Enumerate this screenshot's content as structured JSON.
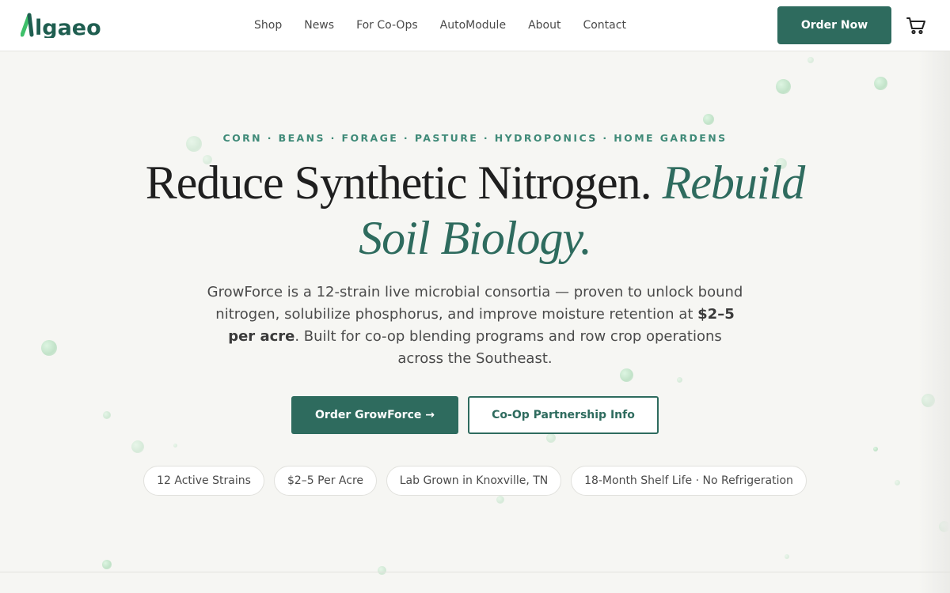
{
  "brand": {
    "logo_text": "lgaeo",
    "logo_color": "#1f5e50",
    "logo_accent": "#3ec06a"
  },
  "nav": {
    "items": [
      {
        "label": "Shop"
      },
      {
        "label": "News"
      },
      {
        "label": "For Co-Ops"
      },
      {
        "label": "AutoModule"
      },
      {
        "label": "About"
      },
      {
        "label": "Contact"
      }
    ],
    "order_label": "Order Now",
    "cart_icon": "cart-icon"
  },
  "hero": {
    "eyebrow": "CORN · BEANS · FORAGE · PASTURE · HYDROPONICS · HOME GARDENS",
    "headline_plain": "Reduce Synthetic Nitrogen.",
    "headline_accent": "Rebuild Soil Biology.",
    "lede_before": "GrowForce is a 12-strain live microbial consortia — proven to unlock bound nitrogen, solubilize phosphorus, and improve moisture retention at ",
    "lede_bold": "$2–5 per acre",
    "lede_after": ". Built for co-op blending programs and row crop operations across the Southeast.",
    "cta_primary": "Order GrowForce →",
    "cta_secondary": "Co-Op Partnership Info",
    "pills": [
      {
        "label": "12 Active Strains"
      },
      {
        "label": "$2–5 Per Acre"
      },
      {
        "label": "Lab Grown in Knoxville, TN"
      },
      {
        "label": "18-Month Shelf Life · No Refrigeration"
      }
    ]
  },
  "colors": {
    "primary": "#2e6b5e",
    "eyebrow": "#3f8a78",
    "background": "#f6f6f3"
  }
}
